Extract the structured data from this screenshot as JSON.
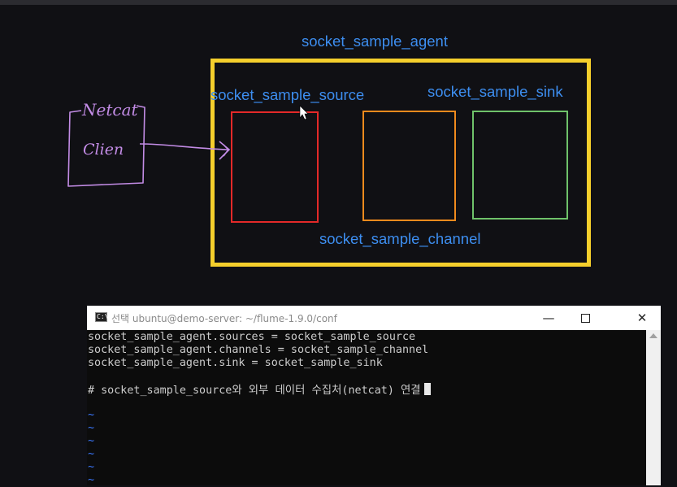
{
  "diagram": {
    "agent_label": "socket_sample_agent",
    "source_label": "socket_sample_source",
    "sink_label": "socket_sample_sink",
    "channel_label": "socket_sample_channel",
    "client_title": "Netcat",
    "client_label": "Clien",
    "colors": {
      "label_blue": "#3d8ef0",
      "agent_border": "#f5cf2c",
      "source_border": "#e32929",
      "channel_border": "#f08a1d",
      "sink_border": "#6fc26a",
      "handwriting": "#c38ce6"
    }
  },
  "terminal": {
    "title": "선택 ubuntu@demo-server: ~/flume-1.9.0/conf",
    "icon": "console-icon",
    "controls": {
      "minimize": "—",
      "close": "✕"
    },
    "lines": [
      "socket_sample_agent.sources = socket_sample_source",
      "socket_sample_agent.channels = socket_sample_channel",
      "socket_sample_agent.sink = socket_sample_sink",
      "",
      "# socket_sample_source와 외부 데이터 수집처(netcat) 연결"
    ],
    "tildes": [
      "~",
      "~",
      "~",
      "~",
      "~",
      "~"
    ]
  }
}
